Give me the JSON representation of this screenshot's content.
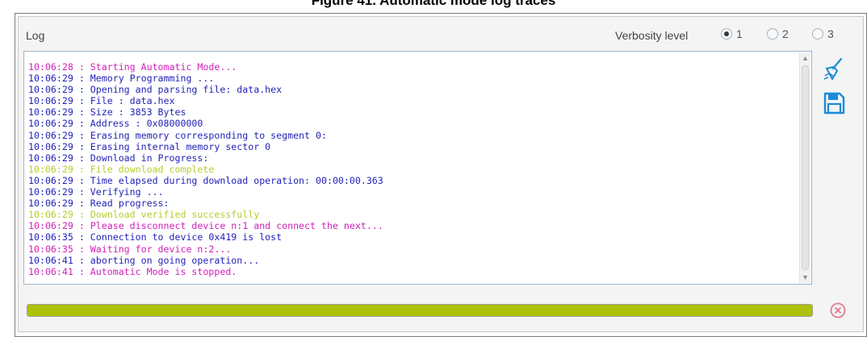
{
  "caption": "Figure 41. Automatic mode log traces",
  "panel": {
    "title": "Log",
    "verbosity_label": "Verbosity level",
    "verbosity_options": [
      "1",
      "2",
      "3"
    ],
    "verbosity_selected": "1"
  },
  "log_lines": [
    {
      "time": "10:06:28",
      "text": "Starting Automatic Mode...",
      "kind": "magenta"
    },
    {
      "time": "10:06:29",
      "text": "Memory Programming ...",
      "kind": "info"
    },
    {
      "time": "10:06:29",
      "text": "Opening and parsing file: data.hex",
      "kind": "info"
    },
    {
      "time": "10:06:29",
      "text": "File : data.hex",
      "kind": "info"
    },
    {
      "time": "10:06:29",
      "text": "Size : 3853 Bytes",
      "kind": "info"
    },
    {
      "time": "10:06:29",
      "text": "Address : 0x08000000",
      "kind": "info"
    },
    {
      "time": "10:06:29",
      "text": "Erasing memory corresponding to segment 0:",
      "kind": "info"
    },
    {
      "time": "10:06:29",
      "text": "Erasing internal memory sector 0",
      "kind": "info"
    },
    {
      "time": "10:06:29",
      "text": "Download in Progress:",
      "kind": "info"
    },
    {
      "time": "10:06:29",
      "text": "File download complete",
      "kind": "success"
    },
    {
      "time": "10:06:29",
      "text": "Time elapsed during download operation: 00:00:00.363",
      "kind": "info"
    },
    {
      "time": "10:06:29",
      "text": "Verifying ...",
      "kind": "info"
    },
    {
      "time": "10:06:29",
      "text": "Read progress:",
      "kind": "info"
    },
    {
      "time": "10:06:29",
      "text": "Download verified successfully",
      "kind": "success"
    },
    {
      "time": "10:06:29",
      "text": "Please disconnect device n:1 and connect the next...",
      "kind": "magenta"
    },
    {
      "time": "10:06:35",
      "text": "Connection to device 0x419 is lost",
      "kind": "info"
    },
    {
      "time": "10:06:35",
      "text": "Waiting for device n:2...",
      "kind": "magenta"
    },
    {
      "time": "10:06:41",
      "text": "aborting on going operation...",
      "kind": "info"
    },
    {
      "time": "10:06:41",
      "text": "Automatic Mode is stopped.",
      "kind": "magenta"
    }
  ],
  "colors": {
    "info": "#1f1fb8",
    "magenta": "#d020b8",
    "success": "#b8cc2a",
    "progress": "#adc10a",
    "accent": "#1a8bd6",
    "stop": "#e07a8f"
  },
  "icons": {
    "clear": "broom-icon",
    "save": "save-icon",
    "stop": "stop-circle-icon"
  },
  "progress": {
    "fraction": 1.0
  }
}
